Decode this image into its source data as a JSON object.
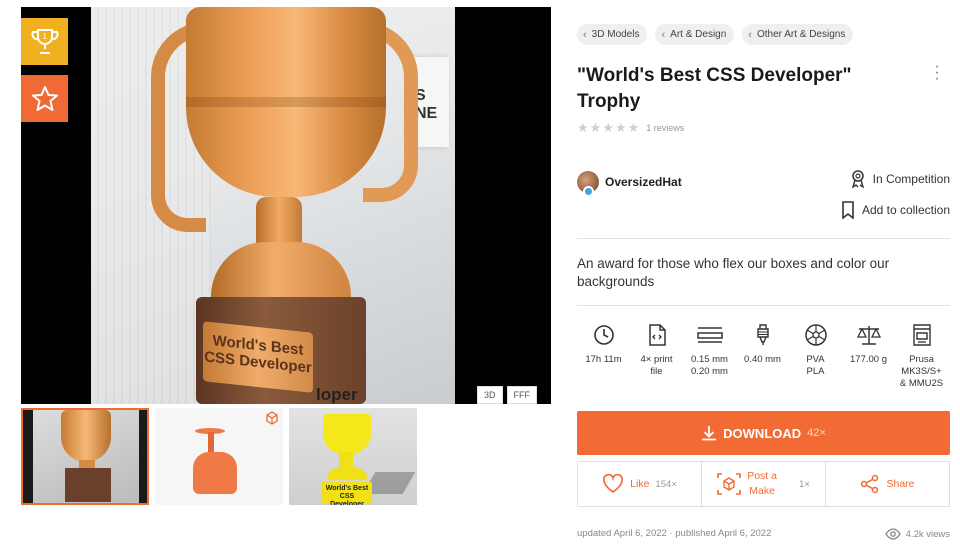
{
  "gallery": {
    "photo_plate_text": "World's Best CSS Developer",
    "photo_suffix_text": "loper",
    "viewer_tags": [
      "3D",
      "FFF"
    ],
    "thumb3_plate_text": "World's Best CSS Developer"
  },
  "breadcrumbs": [
    "3D Models",
    "Art & Design",
    "Other Art & Designs"
  ],
  "title": "\"World's Best CSS Developer\" Trophy",
  "rating": {
    "stars": 0,
    "reviews": "1 reviews"
  },
  "author": {
    "name": "OversizedHat"
  },
  "competition_label": "In Competition",
  "add_collection_label": "Add to collection",
  "description": "An award for those who flex our boxes and color our backgrounds",
  "specs": [
    {
      "icon": "clock-icon",
      "value": "17h 11m"
    },
    {
      "icon": "file-icon",
      "value": "4× print\nfile"
    },
    {
      "icon": "layer-height-icon",
      "value": "0.15 mm\n0.20 mm"
    },
    {
      "icon": "nozzle-icon",
      "value": "0.40 mm"
    },
    {
      "icon": "filament-spool-icon",
      "value": "PVA\nPLA"
    },
    {
      "icon": "weight-scale-icon",
      "value": "177.00 g"
    },
    {
      "icon": "printer-icon",
      "value": "Prusa\nMK3S/S+\n& MMU2S"
    }
  ],
  "download": {
    "label": "DOWNLOAD",
    "count": "42×"
  },
  "actions": {
    "like_label": "Like",
    "like_count": "154×",
    "post_make_label_1": "Post a",
    "post_make_label_2": "Make",
    "post_make_count": "1×",
    "share_label": "Share"
  },
  "meta": {
    "updated": "updated April 6, 2022",
    "published": "published April 6, 2022",
    "views": "4.2k views"
  },
  "colors": {
    "accent": "#f26b35",
    "contest_badge": "#f0b020"
  }
}
